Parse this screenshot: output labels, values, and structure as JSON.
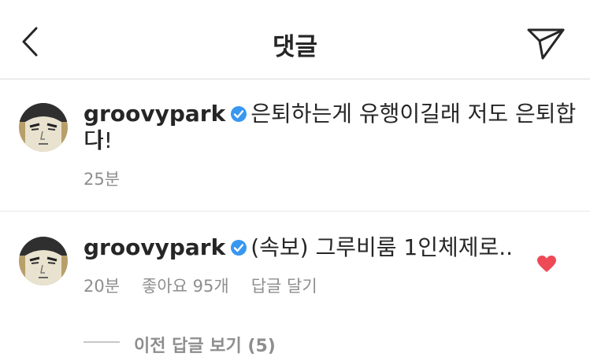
{
  "header": {
    "title": "댓글",
    "back_icon": "chevron-left-icon",
    "send_icon": "paper-plane-icon"
  },
  "comments": [
    {
      "username": "groovypark",
      "text_line1": "은퇴하는게 유행이길래 저도 은퇴합니",
      "text_line2": "다!",
      "time": "25분"
    },
    {
      "username": "groovypark",
      "text_line1": "(속보) 그루비룸 1인체제로..",
      "time": "20분",
      "likes": "좋아요 95개",
      "reply_label": "답글 달기",
      "liked": true
    }
  ],
  "view_previous_replies": "이전 답글 보기 (5)",
  "colors": {
    "verified": "#3897f0",
    "heart": "#ed4956",
    "meta_text": "#8e8e8e"
  }
}
